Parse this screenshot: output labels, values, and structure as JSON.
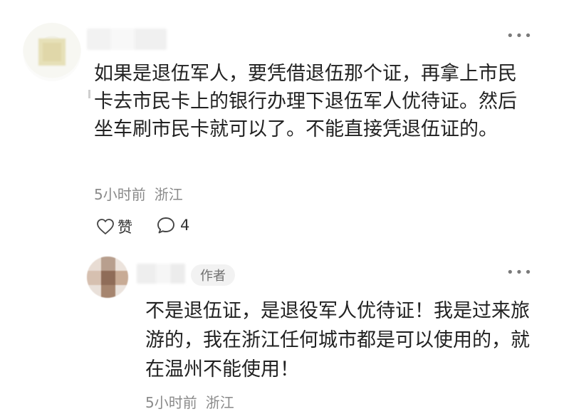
{
  "main_comment": {
    "text": "如果是退伍军人，要凭借退伍那个证，再拿上市民卡去市民卡上的银行办理下退伍军人优待证。然后坐车刷市民卡就可以了。不能直接凭退伍证的。",
    "time": "5小时前",
    "location": "浙江",
    "like_label": "赞",
    "reply_count": "4",
    "more_icon": "more-dots-icon"
  },
  "reply": {
    "badge": "作者",
    "text": "不是退伍证，是退役军人优待证！我是过来旅游的，我在浙江任何城市都是可以使用的，就在温州不能使用！",
    "time": "5小时前",
    "location": "浙江",
    "more_icon": "more-dots-icon"
  },
  "icons": {
    "like": "heart-outline-icon",
    "comment": "speech-bubble-icon"
  }
}
